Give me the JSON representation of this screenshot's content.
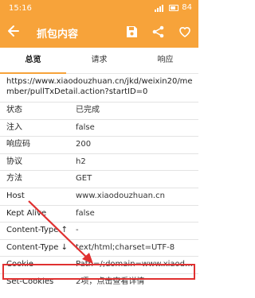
{
  "status_bar": {
    "time": "15:16",
    "battery": "84"
  },
  "toolbar": {
    "title": "抓包内容",
    "icons": [
      "back-arrow-icon",
      "save-icon",
      "share-icon",
      "heart-icon"
    ]
  },
  "tabs": [
    {
      "label": "总览",
      "active": true
    },
    {
      "label": "请求",
      "active": false
    },
    {
      "label": "响应",
      "active": false
    }
  ],
  "url": "https://www.xiaodouzhuan.cn/jkd/weixin20/member/pullTxDetail.action?startID=0",
  "details": [
    {
      "key": "状态",
      "value": "已完成"
    },
    {
      "key": "注入",
      "value": "false"
    },
    {
      "key": "响应码",
      "value": "200"
    },
    {
      "key": "协议",
      "value": "h2"
    },
    {
      "key": "方法",
      "value": "GET"
    },
    {
      "key": "Host",
      "value": "www.xiaodouzhuan.cn"
    },
    {
      "key": "Kept Alive",
      "value": "false"
    },
    {
      "key": "Content-Type ↑",
      "value": "-"
    },
    {
      "key": "Content-Type ↓",
      "value": "text/html;charset=UTF-8"
    },
    {
      "key": "Cookie",
      "value": "Path=/;domain=www.xiaodouzhuan.cn"
    },
    {
      "key": "Set-Cookies",
      "value": "2项，点击查看详情"
    }
  ],
  "colors": {
    "accent": "#f7a33a",
    "highlight": "#e03030"
  }
}
